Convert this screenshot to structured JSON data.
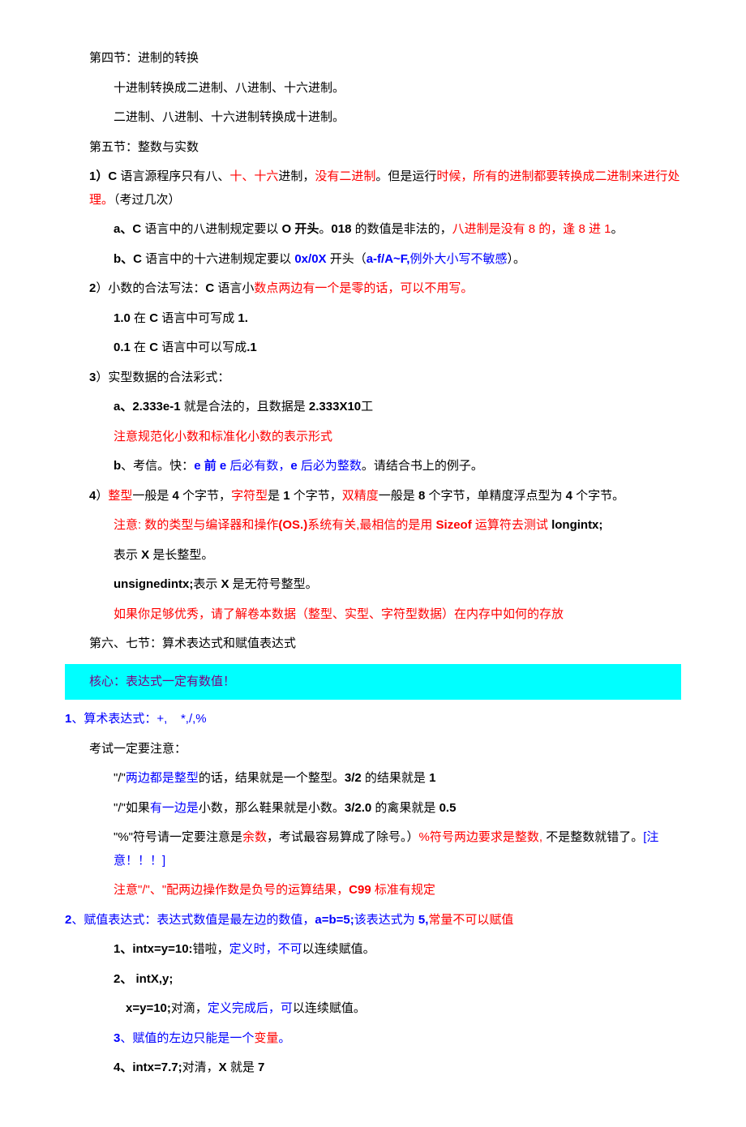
{
  "s4_title": "第四节：进制的转换",
  "s4_l1": "十进制转换成二进制、八进制、十六进制。",
  "s4_l2": "二进制、八进制、十六进制转换成十进制。",
  "s5_title": "第五节：整数与实数",
  "s5_1_a": "1）C",
  "s5_1_b": " 语言源程序只有八、",
  "s5_1_c": "十、十六",
  "s5_1_d": "进制，",
  "s5_1_e": "没有二进制",
  "s5_1_f": "。但是运行",
  "s5_1_g": "时候，所有的进制都要转换成二进制来进行处理。",
  "s5_1_h": "（考过几次）",
  "s5_1a_a": "a、C",
  "s5_1a_b": " 语言中的八进制规定要以 ",
  "s5_1a_c": "O 开头",
  "s5_1a_d": "。",
  "s5_1a_e": "018",
  "s5_1a_f": " 的数值是非法的，",
  "s5_1a_g": "八进制是没有 8 的，逢 8 进 1",
  "s5_1a_h": "。",
  "s5_1b_a": "b、C",
  "s5_1b_b": " 语言中的十六进制规定要以 ",
  "s5_1b_c": "0x/0X",
  "s5_1b_d": " 开头（",
  "s5_1b_e": "a-f/A~F,",
  "s5_1b_f": "例外大小写不敏感",
  "s5_1b_g": "）。",
  "s5_2_a": "2",
  "s5_2_b": "）小数的合法写法：",
  "s5_2_c": "C ",
  "s5_2_d": "语言小",
  "s5_2_e": "数点两边有一个是零的话，可以不用写。",
  "s5_2a_a": "1.0",
  "s5_2a_b": " 在 ",
  "s5_2a_c": "C ",
  "s5_2a_d": "语言中可写成 ",
  "s5_2a_e": "1.",
  "s5_2b_a": "0.1",
  "s5_2b_b": " 在 ",
  "s5_2b_c": "C ",
  "s5_2b_d": "语言中可以写成",
  "s5_2b_e": ".1",
  "s5_3_a": "3",
  "s5_3_b": "）实型数据的合法彩式：",
  "s5_3a_a": "a、2.333e-1",
  "s5_3a_b": " 就是合法的，且数据是 ",
  "s5_3a_c": "2.333X10",
  "s5_3a_d": "工",
  "s5_3b": "注意规范化小数和标准化小数的表示形式",
  "s5_3c_a": "b",
  "s5_3c_b": "、考信。快：",
  "s5_3c_c": "e 前 e",
  "s5_3c_d": " 后必有数，",
  "s5_3c_e": "e ",
  "s5_3c_f": "后必为整数",
  "s5_3c_g": "。请结合书上的例子。",
  "s5_4_a": "4",
  "s5_4_b": "）",
  "s5_4_c": "整型",
  "s5_4_d": "一般是 ",
  "s5_4_e": "4",
  "s5_4_f": " 个字节，",
  "s5_4_g": "字符型",
  "s5_4_h": "是 ",
  "s5_4_i": "1",
  "s5_4_j": " 个字节，",
  "s5_4_k": "双精度",
  "s5_4_l": "一般是 ",
  "s5_4_m": "8",
  "s5_4_n": " 个字节，单精度浮点型为 ",
  "s5_4_o": "4",
  "s5_4_p": " 个字节。",
  "s5_note_a": "注意: ",
  "s5_note_b": "数的类型与编译器和操作",
  "s5_note_c": "(OS.)",
  "s5_note_d": "系统有关,最相信的是用 ",
  "s5_note_e": "Sizeof",
  "s5_note_f": " 运算符去测试 ",
  "s5_note_g": "longintx;",
  "s5_x1_a": "表示 ",
  "s5_x1_b": "X",
  "s5_x1_c": " 是长整型。",
  "s5_x2_a": "unsignedintx;",
  "s5_x2_b": "表示 ",
  "s5_x2_c": "X",
  "s5_x2_d": " 是无符号整型。",
  "s5_end": "如果你足够优秀，请了解卷本数据（整型、实型、字符型数据）在内存中如何的存放",
  "s67_title": "第六、七节：算术表达式和赋值表达式",
  "hl_a": "核心：表达式一定有数值！",
  "a1_a": "1",
  "a1_b": "、算术表达式：",
  "a1_c": "+,",
  "a1_d": "*,/,%",
  "a1_note": "考试一定要注意：",
  "a1_l1_a": "\"/\"",
  "a1_l1_b": "两边都是整型",
  "a1_l1_c": "的话，结果就是一个整型。",
  "a1_l1_d": "3/2",
  "a1_l1_e": " 的结果就是 ",
  "a1_l1_f": "1",
  "a1_l2_a": "\"/\"",
  "a1_l2_b": "如果",
  "a1_l2_c": "有一边是",
  "a1_l2_d": "小数，那么鞋果就是小数。",
  "a1_l2_e": "3/2.0",
  "a1_l2_f": " 的禽果就是 ",
  "a1_l2_g": "0.5",
  "a1_l3_a": "\"%\"",
  "a1_l3_b": "符号请一定要注意是",
  "a1_l3_c": "余数",
  "a1_l3_d": "，考试最容易算成了除号。）",
  "a1_l3_e": "%符号两边要求是整数, ",
  "a1_l3_f": "不是整数就错了。",
  "a1_l3_g": "[注意！！！]",
  "a1_l4_a": "注意\"/\"、\"配两边操作数是负号的运算结果，",
  "a1_l4_b": "C99 ",
  "a1_l4_c": "标准有规定",
  "a2_a": "2",
  "a2_b": "、赋值表达式：表达式数值是最左边的数值，",
  "a2_c": "a=b=5;",
  "a2_d": "该表达式为 ",
  "a2_e": "5,",
  "a2_f": "常量不可以赋值",
  "a2_1_a": "1、intx=y=10:",
  "a2_1_b": "错啦，",
  "a2_1_c": "定义时，不可",
  "a2_1_d": "以连续赋值。",
  "a2_2_a": "2、 intX,y;",
  "a2_2b_a": "x=y=10;",
  "a2_2b_b": "对滴，",
  "a2_2b_c": "定义完成后，可",
  "a2_2b_d": "以连续赋值。",
  "a2_3_a": "3",
  "a2_3_b": "、赋值的左边只能是一个",
  "a2_3_c": "变量",
  "a2_3_d": "。",
  "a2_4_a": "4、intx=7.7;",
  "a2_4_b": "对清，",
  "a2_4_c": "X ",
  "a2_4_d": "就是 ",
  "a2_4_e": "7"
}
